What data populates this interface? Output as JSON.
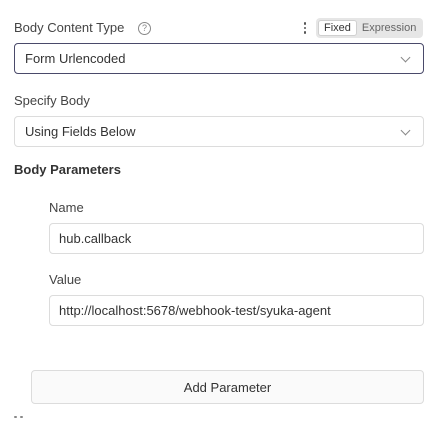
{
  "body_content_type": {
    "label": "Body Content Type",
    "help_icon": "question-circle-icon",
    "options_icon": "kebab-menu-icon",
    "mode_toggle": {
      "fixed": "Fixed",
      "expression": "Expression",
      "selected": "Fixed"
    },
    "value": "Form Urlencoded"
  },
  "specify_body": {
    "label": "Specify Body",
    "value": "Using Fields Below"
  },
  "body_parameters": {
    "label": "Body Parameters",
    "items": [
      {
        "name_label": "Name",
        "name_value": "hub.callback",
        "value_label": "Value",
        "value_value": "http://localhost:5678/webhook-test/syuka-agent"
      }
    ],
    "add_button": "Add Parameter"
  },
  "colors": {
    "focused_border": "#4a4a6a",
    "border": "#dcdcdc",
    "toggle_bg": "#e6e6e6"
  }
}
